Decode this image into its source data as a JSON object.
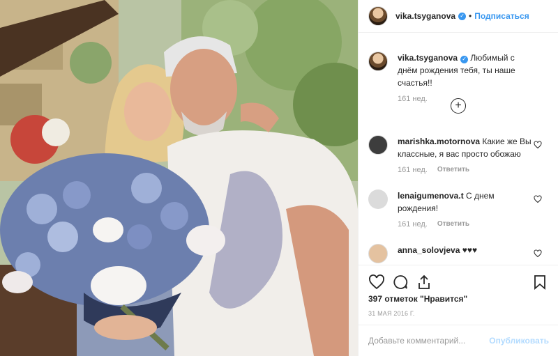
{
  "header": {
    "username": "vika.tsyganova",
    "dot": "•",
    "follow_label": "Подписаться"
  },
  "caption": {
    "username": "vika.tsyganova",
    "text": "Любимый с днём рождения тебя, ты наше счастья!!",
    "time": "161 нед."
  },
  "load_more_icon": "plus-circle-icon",
  "comments": [
    {
      "username": "marishka.motornova",
      "text": "Какие же Вы классные, я вас просто обожаю",
      "time": "161 нед.",
      "reply": "Ответить"
    },
    {
      "username": "lenaigumenova.t",
      "text": "С днем рождения!",
      "time": "161 нед.",
      "reply": "Ответить"
    },
    {
      "username": "anna_solovjeva",
      "text": "♥♥♥",
      "time": "",
      "reply": ""
    }
  ],
  "likes": "397 отметок \"Нравится\"",
  "date": "31 МАЯ 2016 Г.",
  "add_comment": {
    "placeholder": "Добавьте комментарий...",
    "post_label": "Опубликовать"
  },
  "colors": {
    "link": "#3897f0",
    "muted": "#999999",
    "post_disabled": "#b3dbff"
  }
}
